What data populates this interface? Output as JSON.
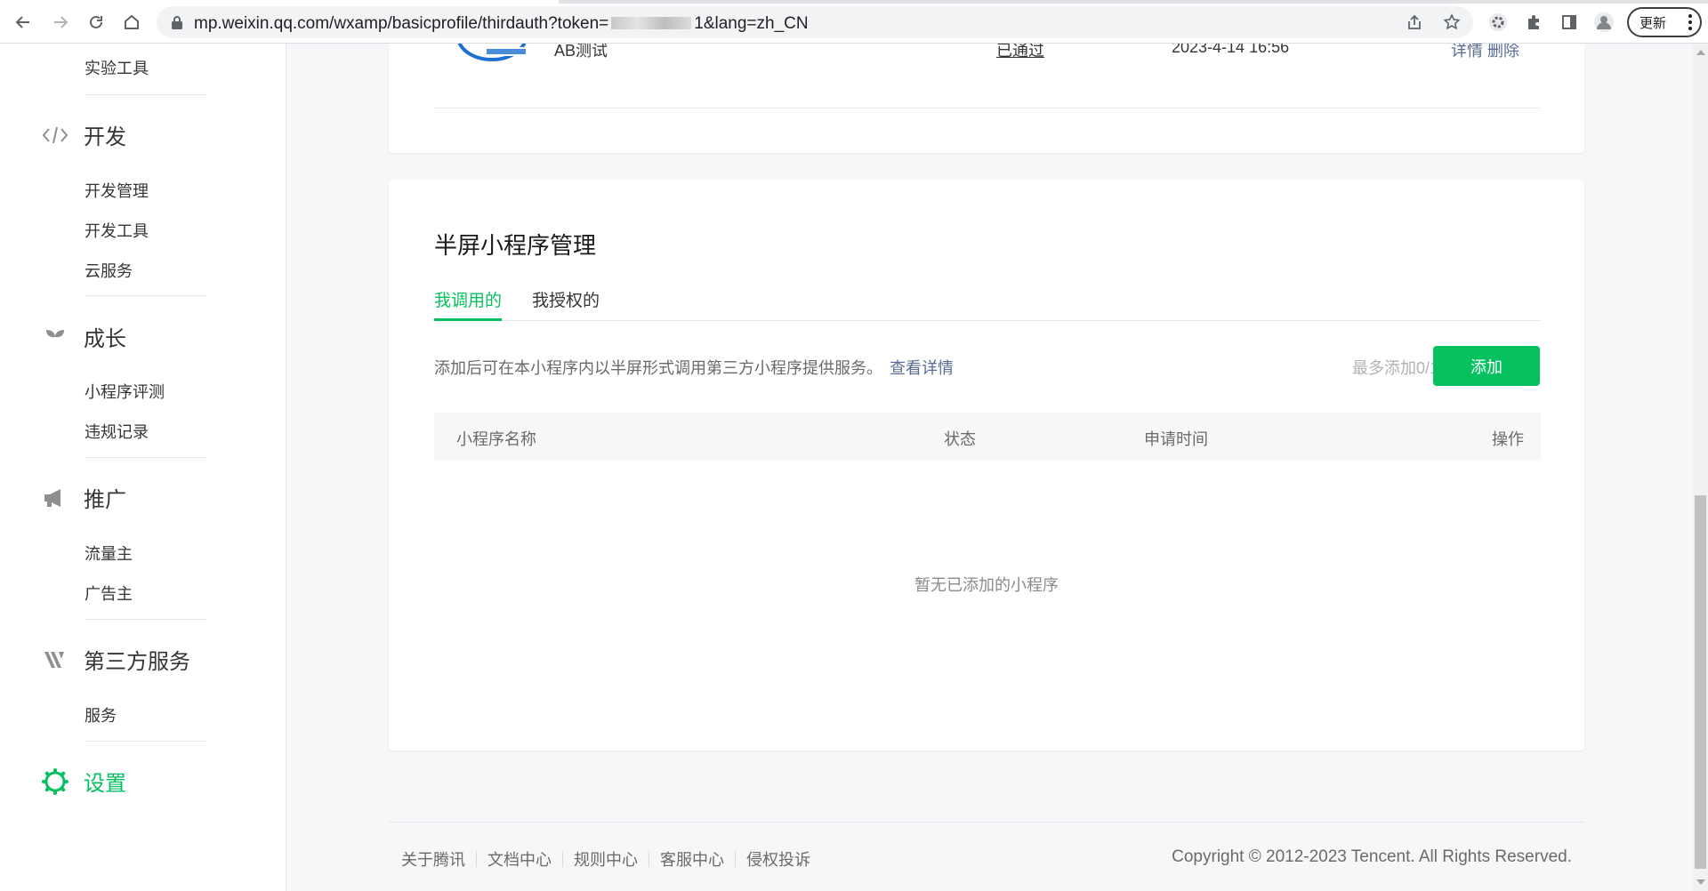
{
  "browser": {
    "url_prefix": "mp.weixin.qq.com/wxamp/basicprofile/thirdauth?token=",
    "url_suffix": "1&lang=zh_CN",
    "update_label": "更新"
  },
  "sidebar": {
    "top_item": "实验工具",
    "sections": [
      {
        "title": "开发",
        "icon": "code-icon",
        "items": [
          "开发管理",
          "开发工具",
          "云服务"
        ]
      },
      {
        "title": "成长",
        "icon": "sprout-icon",
        "items": [
          "小程序评测",
          "违规记录"
        ]
      },
      {
        "title": "推广",
        "icon": "megaphone-icon",
        "items": [
          "流量主",
          "广告主"
        ]
      },
      {
        "title": "第三方服务",
        "icon": "third-party-icon",
        "items": [
          "服务"
        ]
      },
      {
        "title": "设置",
        "icon": "gear-icon",
        "items": []
      }
    ],
    "active_color": "#07c160"
  },
  "top_card": {
    "row_name": "AB测试",
    "row_status": "已通过",
    "row_time": "2023-4-14 16:56",
    "row_actions": "详情  删除"
  },
  "panel": {
    "title": "半屏小程序管理",
    "tabs": [
      "我调用的",
      "我授权的"
    ],
    "description": "添加后可在本小程序内以半屏形式调用第三方小程序提供服务。",
    "detail_link": "查看详情",
    "limit_text": "最多添加0/10",
    "add_button": "添加",
    "columns": [
      "小程序名称",
      "状态",
      "申请时间",
      "操作"
    ],
    "empty_text": "暂无已添加的小程序"
  },
  "footer": {
    "links": [
      "关于腾讯",
      "文档中心",
      "规则中心",
      "客服中心",
      "侵权投诉"
    ],
    "copyright": "Copyright © 2012-2023 Tencent. All Rights Reserved."
  },
  "colors": {
    "brand_green": "#07c160",
    "link_blue": "#576b95"
  }
}
